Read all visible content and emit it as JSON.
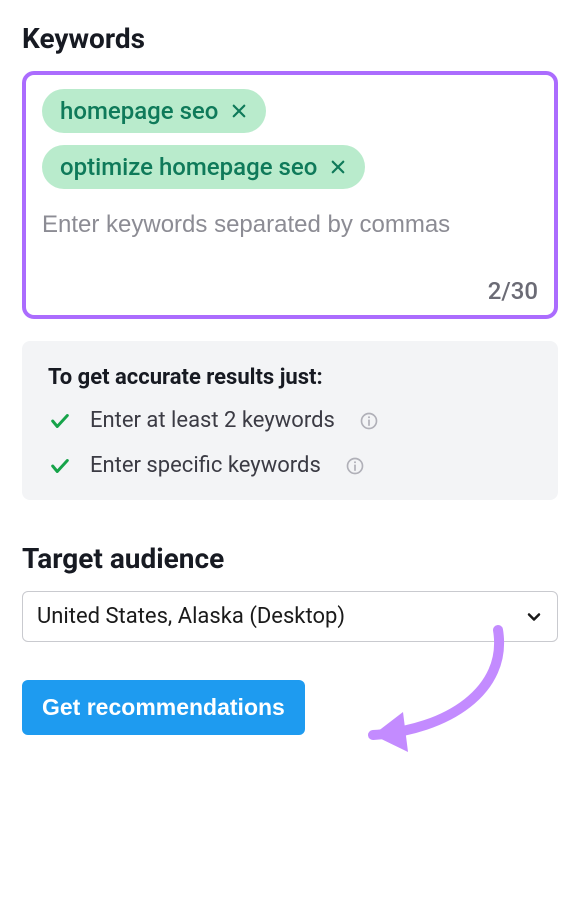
{
  "sections": {
    "keywords": {
      "title": "Keywords",
      "tags": [
        "homepage seo",
        "optimize homepage seo"
      ],
      "placeholder": "Enter keywords separated by commas",
      "counter": "2/30"
    },
    "tips": {
      "title": "To get accurate results just:",
      "items": [
        "Enter at least 2 keywords",
        "Enter specific keywords"
      ]
    },
    "target": {
      "title": "Target audience",
      "selected": "United States, Alaska (Desktop)"
    },
    "cta": {
      "label": "Get recommendations"
    }
  }
}
